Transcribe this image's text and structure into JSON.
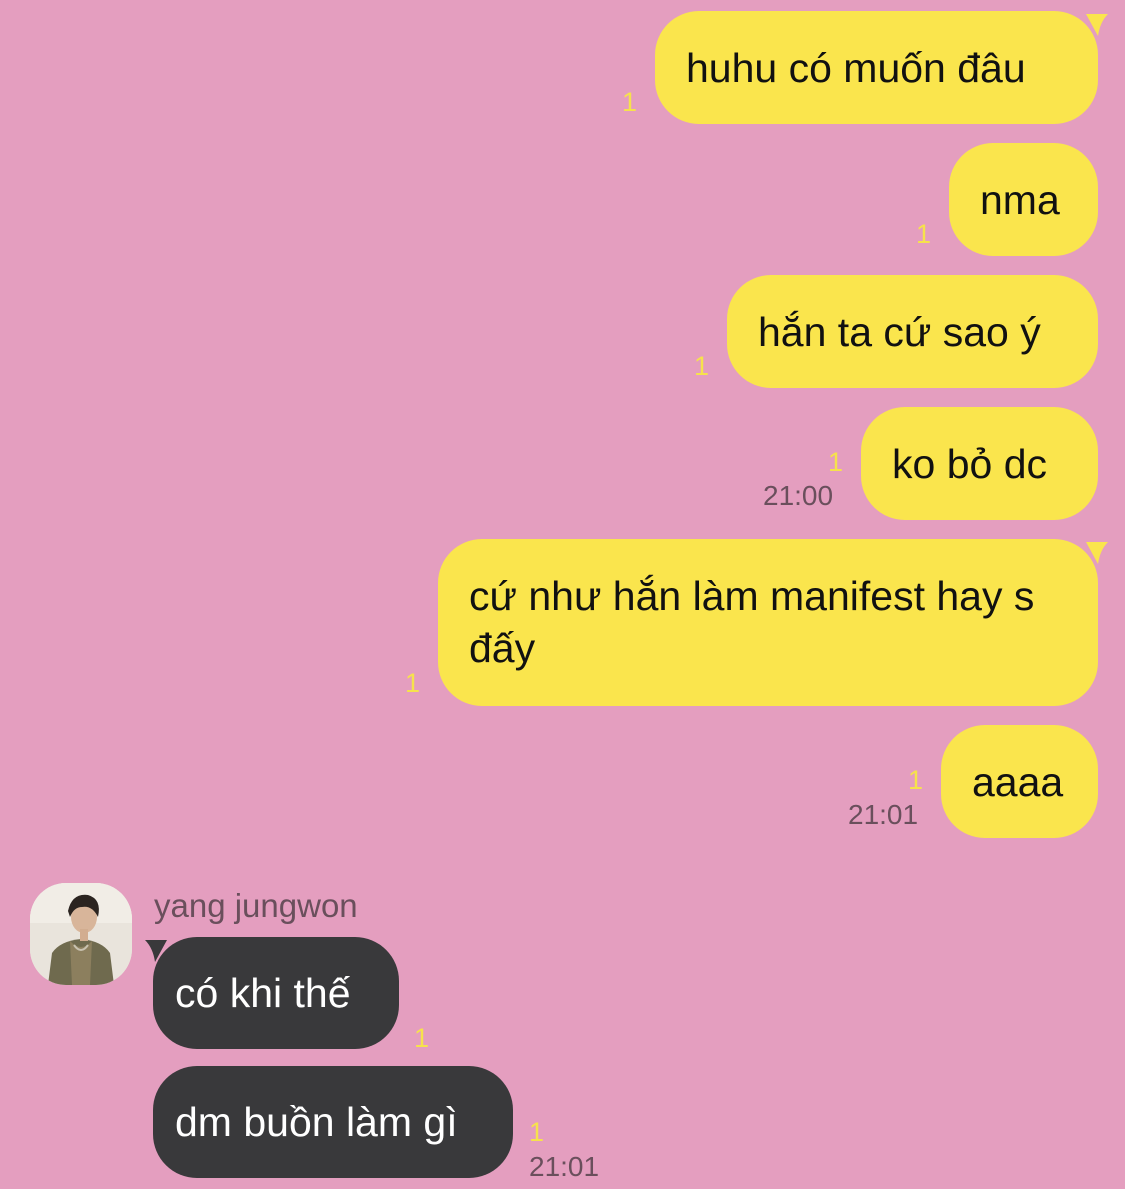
{
  "chat": {
    "colors": {
      "background": "#e49ebf",
      "my_bubble": "#fae54d",
      "their_bubble": "#39393b",
      "unread_count": "#f6e24c"
    },
    "outgoing": [
      {
        "text": "huhu có muốn đâu",
        "unread": "1",
        "time": ""
      },
      {
        "text": "nma",
        "unread": "1",
        "time": ""
      },
      {
        "text": "hắn ta cứ sao ý",
        "unread": "1",
        "time": ""
      },
      {
        "text": "ko bỏ dc",
        "unread": "1",
        "time": "21:00"
      },
      {
        "text": "cứ như hắn làm manifest hay s đấy",
        "unread": "1",
        "time": ""
      },
      {
        "text": "aaaa",
        "unread": "1",
        "time": "21:01"
      }
    ],
    "incoming": {
      "sender": "yang jungwon",
      "avatar_icon": "profile-photo",
      "messages": [
        {
          "text": "có khi thế",
          "unread": "1",
          "time": ""
        },
        {
          "text": "dm buồn làm gì",
          "unread": "1",
          "time": "21:01"
        }
      ]
    }
  }
}
